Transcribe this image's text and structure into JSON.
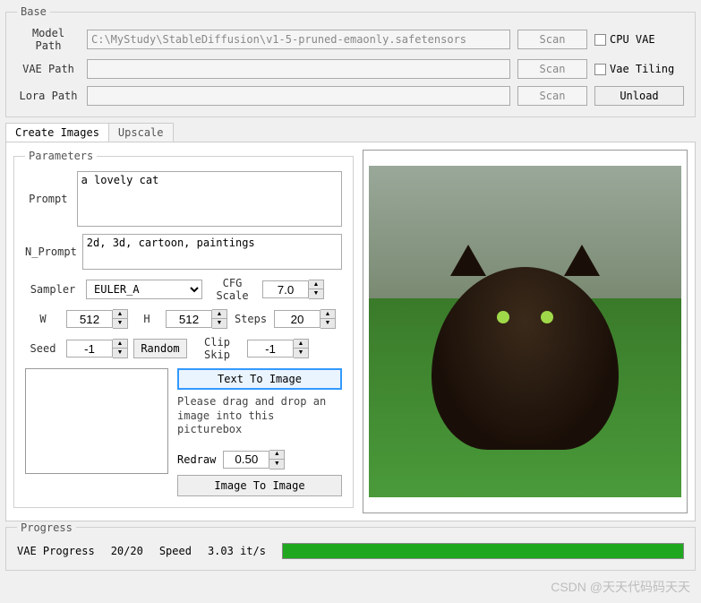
{
  "base": {
    "legend": "Base",
    "model_path_label": "Model Path",
    "model_path_value": "C:\\MyStudy\\StableDiffusion\\v1-5-pruned-emaonly.safetensors",
    "vae_path_label": "VAE Path",
    "vae_path_value": "",
    "lora_path_label": "Lora Path",
    "lora_path_value": "",
    "scan_label": "Scan",
    "unload_label": "Unload",
    "cpu_vae_label": "CPU VAE",
    "vae_tiling_label": "Vae Tiling"
  },
  "tabs": {
    "create": "Create Images",
    "upscale": "Upscale"
  },
  "params": {
    "legend": "Parameters",
    "prompt_label": "Prompt",
    "prompt_value": "a lovely cat",
    "nprompt_label": "N_Prompt",
    "nprompt_value": "2d, 3d, cartoon, paintings",
    "sampler_label": "Sampler",
    "sampler_value": "EULER_A",
    "cfg_label": "CFG Scale",
    "cfg_value": "7.0",
    "w_label": "W",
    "w_value": "512",
    "h_label": "H",
    "h_value": "512",
    "steps_label": "Steps",
    "steps_value": "20",
    "seed_label": "Seed",
    "seed_value": "-1",
    "random_label": "Random",
    "clipskip_label": "Clip Skip",
    "clipskip_value": "-1",
    "text2img_label": "Text To Image",
    "drag_text": "Please drag and drop an image into this picturebox",
    "redraw_label": "Redraw",
    "redraw_value": "0.50",
    "img2img_label": "Image To Image"
  },
  "progress": {
    "legend": "Progress",
    "vae_label": "VAE Progress",
    "vae_value": "20/20",
    "speed_label": "Speed",
    "speed_value": "3.03 it/s",
    "percent": 100
  },
  "watermark": "CSDN @天天代码码天天"
}
